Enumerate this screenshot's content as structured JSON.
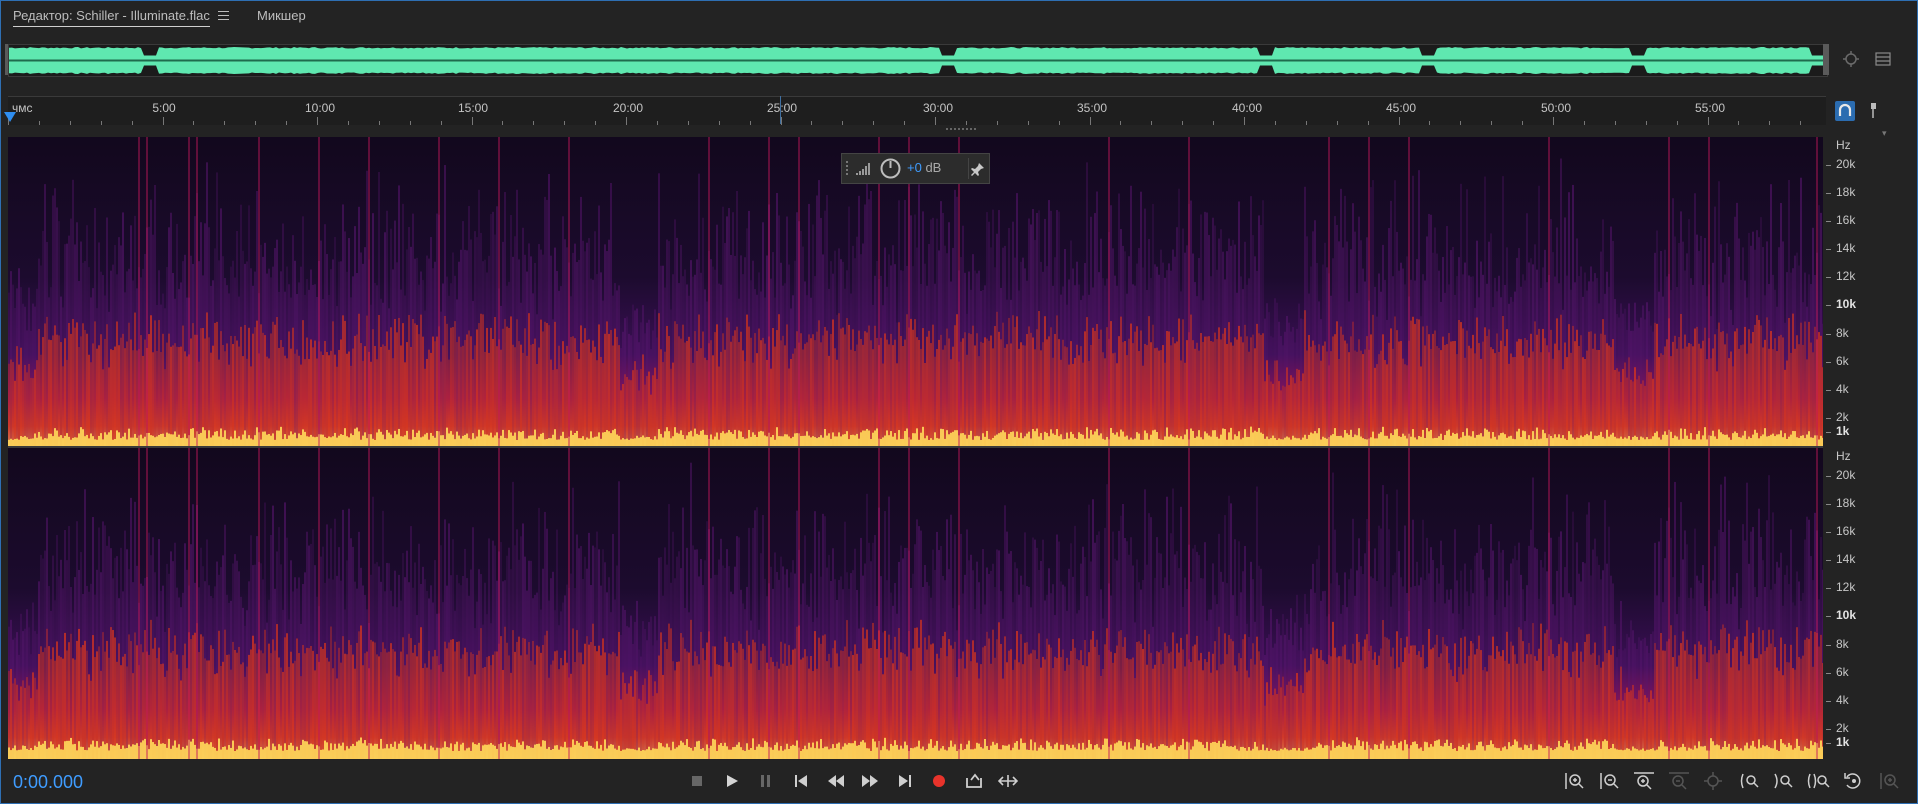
{
  "tabs": {
    "editor_label": "Редактор: Schiller - Illuminate.flac",
    "mixer_label": "Микшер"
  },
  "ruler": {
    "labels": [
      "чмс",
      "5:00",
      "10:00",
      "15:00",
      "20:00",
      "25:00",
      "30:00",
      "35:00",
      "40:00",
      "45:00",
      "50:00",
      "55:00"
    ]
  },
  "hud": {
    "gain_value": "+0",
    "gain_unit": " dB"
  },
  "frequency_scale": {
    "unit": "Hz",
    "labels": [
      "20k",
      "18k",
      "16k",
      "14k",
      "12k",
      "10k",
      "8k",
      "6k",
      "4k",
      "2k",
      "1k"
    ]
  },
  "status": {
    "time": "0:00.000"
  },
  "icons": {
    "transport": [
      "stop-icon",
      "play-icon",
      "pause-icon",
      "go-to-start-icon",
      "rewind-icon",
      "fast-forward-icon",
      "go-to-end-icon",
      "record-icon",
      "loop-icon",
      "skip-selection-icon"
    ],
    "zoom": [
      "zoom-in-amplitude-icon",
      "zoom-out-amplitude-icon",
      "zoom-in-time-icon",
      "zoom-out-time-icon",
      "zoom-out-full-icon",
      "zoom-in-point-in-icon",
      "zoom-in-point-out-icon",
      "zoom-selection-icon",
      "zoom-reset-icon",
      "zoom-tracks-icon"
    ]
  },
  "colors": {
    "accent": "#3f9cff",
    "waveform": "#5fe8b0",
    "record": "#e8332b"
  }
}
